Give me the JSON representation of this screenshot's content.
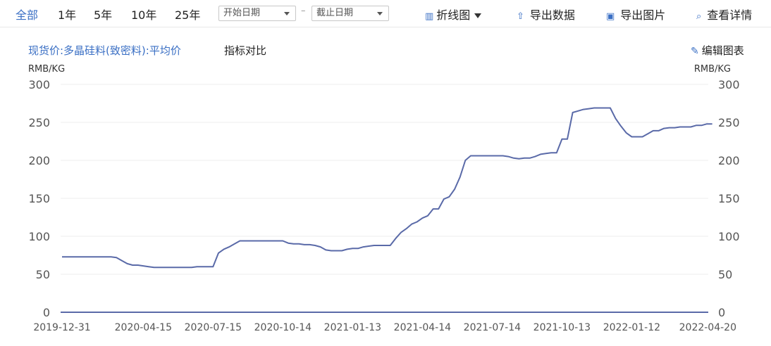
{
  "toolbar": {
    "ranges": [
      "全部",
      "1年",
      "5年",
      "10年",
      "25年"
    ],
    "start_date_placeholder": "开始日期",
    "end_date_placeholder": "截止日期",
    "chart_type_label": "折线图",
    "export_data_label": "导出数据",
    "export_image_label": "导出图片",
    "details_label": "查看详情"
  },
  "header": {
    "title": "现货价:多晶硅料(致密料):平均价",
    "compare_label": "指标对比",
    "edit_label": "编辑图表"
  },
  "colors": {
    "accent": "#3a6fc4",
    "line": "#5a6aa8"
  },
  "chart_data": {
    "type": "line",
    "ylabel_left": "RMB/KG",
    "ylabel_right": "RMB/KG",
    "ylim": [
      0,
      300
    ],
    "yticks": [
      0,
      50,
      100,
      150,
      200,
      250,
      300
    ],
    "xtick_labels": [
      "2019-12-31",
      "2020-04-15",
      "2020-07-15",
      "2020-10-14",
      "2021-01-13",
      "2021-04-14",
      "2021-07-14",
      "2021-10-13",
      "2022-01-12",
      "2022-04-20"
    ],
    "grid": true,
    "series": [
      {
        "x": [
          "2019-12-31",
          "2020-02-05",
          "2020-03-04",
          "2020-03-11",
          "2020-03-18",
          "2020-03-25",
          "2020-04-01",
          "2020-04-08",
          "2020-04-15",
          "2020-04-22",
          "2020-04-29",
          "2020-05-06",
          "2020-05-27",
          "2020-06-10",
          "2020-06-17",
          "2020-06-24",
          "2020-07-01",
          "2020-07-08",
          "2020-07-15",
          "2020-07-22",
          "2020-07-29",
          "2020-08-05",
          "2020-08-12",
          "2020-08-19",
          "2020-08-26",
          "2020-09-02",
          "2020-09-09",
          "2020-09-16",
          "2020-09-23",
          "2020-09-30",
          "2020-10-14",
          "2020-10-21",
          "2020-10-28",
          "2020-11-04",
          "2020-11-11",
          "2020-11-18",
          "2020-11-25",
          "2020-12-02",
          "2020-12-09",
          "2020-12-16",
          "2020-12-23",
          "2020-12-30",
          "2021-01-06",
          "2021-01-13",
          "2021-01-20",
          "2021-01-27",
          "2021-02-03",
          "2021-02-10",
          "2021-02-24",
          "2021-03-03",
          "2021-03-10",
          "2021-03-17",
          "2021-03-24",
          "2021-03-31",
          "2021-04-07",
          "2021-04-14",
          "2021-04-21",
          "2021-04-28",
          "2021-05-05",
          "2021-05-12",
          "2021-05-19",
          "2021-05-26",
          "2021-06-02",
          "2021-06-09",
          "2021-06-16",
          "2021-06-23",
          "2021-06-30",
          "2021-07-07",
          "2021-07-14",
          "2021-07-21",
          "2021-07-28",
          "2021-08-04",
          "2021-08-11",
          "2021-08-18",
          "2021-08-25",
          "2021-09-01",
          "2021-09-08",
          "2021-09-15",
          "2021-09-22",
          "2021-09-29",
          "2021-10-06",
          "2021-10-13",
          "2021-10-20",
          "2021-10-27",
          "2021-11-03",
          "2021-11-10",
          "2021-11-17",
          "2021-11-24",
          "2021-12-01",
          "2021-12-08",
          "2021-12-15",
          "2021-12-22",
          "2021-12-29",
          "2022-01-05",
          "2022-01-12",
          "2022-01-19",
          "2022-01-26",
          "2022-02-02",
          "2022-02-09",
          "2022-02-16",
          "2022-02-23",
          "2022-03-02",
          "2022-03-09",
          "2022-03-16",
          "2022-03-23",
          "2022-03-30",
          "2022-04-06",
          "2022-04-13",
          "2022-04-20",
          "2022-04-27"
        ],
        "values": [
          73,
          73,
          73,
          72,
          68,
          64,
          62,
          62,
          61,
          60,
          59,
          59,
          59,
          59,
          59,
          60,
          60,
          60,
          60,
          78,
          83,
          86,
          90,
          94,
          94,
          94,
          94,
          94,
          94,
          94,
          94,
          91,
          90,
          90,
          89,
          89,
          88,
          86,
          82,
          81,
          81,
          81,
          83,
          84,
          84,
          86,
          87,
          88,
          88,
          88,
          97,
          105,
          110,
          116,
          119,
          124,
          127,
          136,
          136,
          149,
          152,
          162,
          178,
          200,
          206,
          206,
          206,
          206,
          206,
          206,
          206,
          205,
          203,
          202,
          203,
          203,
          205,
          208,
          209,
          210,
          210,
          228,
          228,
          263,
          265,
          267,
          268,
          269,
          269,
          269,
          269,
          255,
          245,
          236,
          231,
          231,
          231,
          235,
          239,
          239,
          242,
          243,
          243,
          244,
          244,
          244,
          246,
          246,
          248,
          248
        ]
      }
    ]
  }
}
